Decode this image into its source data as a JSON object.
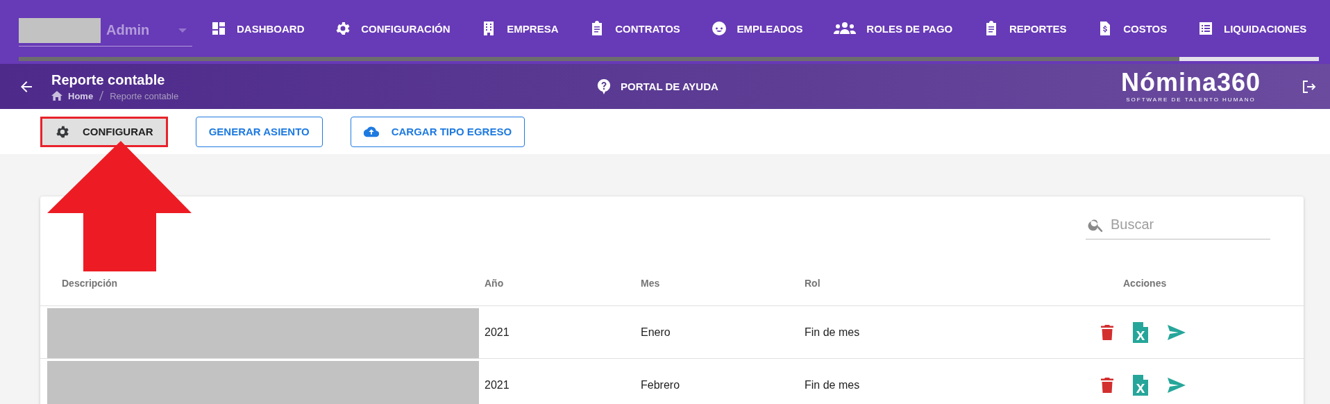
{
  "nav": {
    "user": {
      "role": "Admin"
    },
    "tabs": [
      {
        "label": "DASHBOARD",
        "kind": "dashboard",
        "selected": false
      },
      {
        "label": "CONFIGURACIÓN",
        "kind": "gear",
        "selected": false
      },
      {
        "label": "EMPRESA",
        "kind": "building",
        "selected": false
      },
      {
        "label": "CONTRATOS",
        "kind": "clipboard",
        "selected": false
      },
      {
        "label": "EMPLEADOS",
        "kind": "face",
        "selected": false
      },
      {
        "label": "ROLES DE PAGO",
        "kind": "people",
        "selected": false
      },
      {
        "label": "REPORTES",
        "kind": "clipboard",
        "selected": false
      },
      {
        "label": "COSTOS",
        "kind": "invoice",
        "selected": false
      },
      {
        "label": "LIQUIDACIONES",
        "kind": "list",
        "selected": true
      }
    ]
  },
  "header": {
    "title": "Reporte contable",
    "breadcrumb": [
      {
        "label": "Home"
      },
      {
        "label": "Reporte contable"
      }
    ],
    "help": "PORTAL DE AYUDA",
    "brand": {
      "name": "Nómina360",
      "tagline": "SOFTWARE DE TALENTO HUMANO"
    }
  },
  "toolbar": {
    "buttons": [
      {
        "label": "CONFIGURAR",
        "kind": "flat-gear",
        "annotated": true
      },
      {
        "label": "GENERAR ASIENTO",
        "kind": "outlined",
        "annotated": false
      },
      {
        "label": "CARGAR TIPO EGRESO",
        "kind": "outlined-upload",
        "annotated": false
      }
    ]
  },
  "table": {
    "search": {
      "placeholder": "Buscar"
    },
    "columns": [
      "Descripción",
      "Año",
      "Mes",
      "Rol",
      "Acciones"
    ],
    "rows": [
      {
        "year": "2021",
        "month": "Enero",
        "role": "Fin de mes"
      },
      {
        "year": "2021",
        "month": "Febrero",
        "role": "Fin de mes"
      }
    ]
  }
}
